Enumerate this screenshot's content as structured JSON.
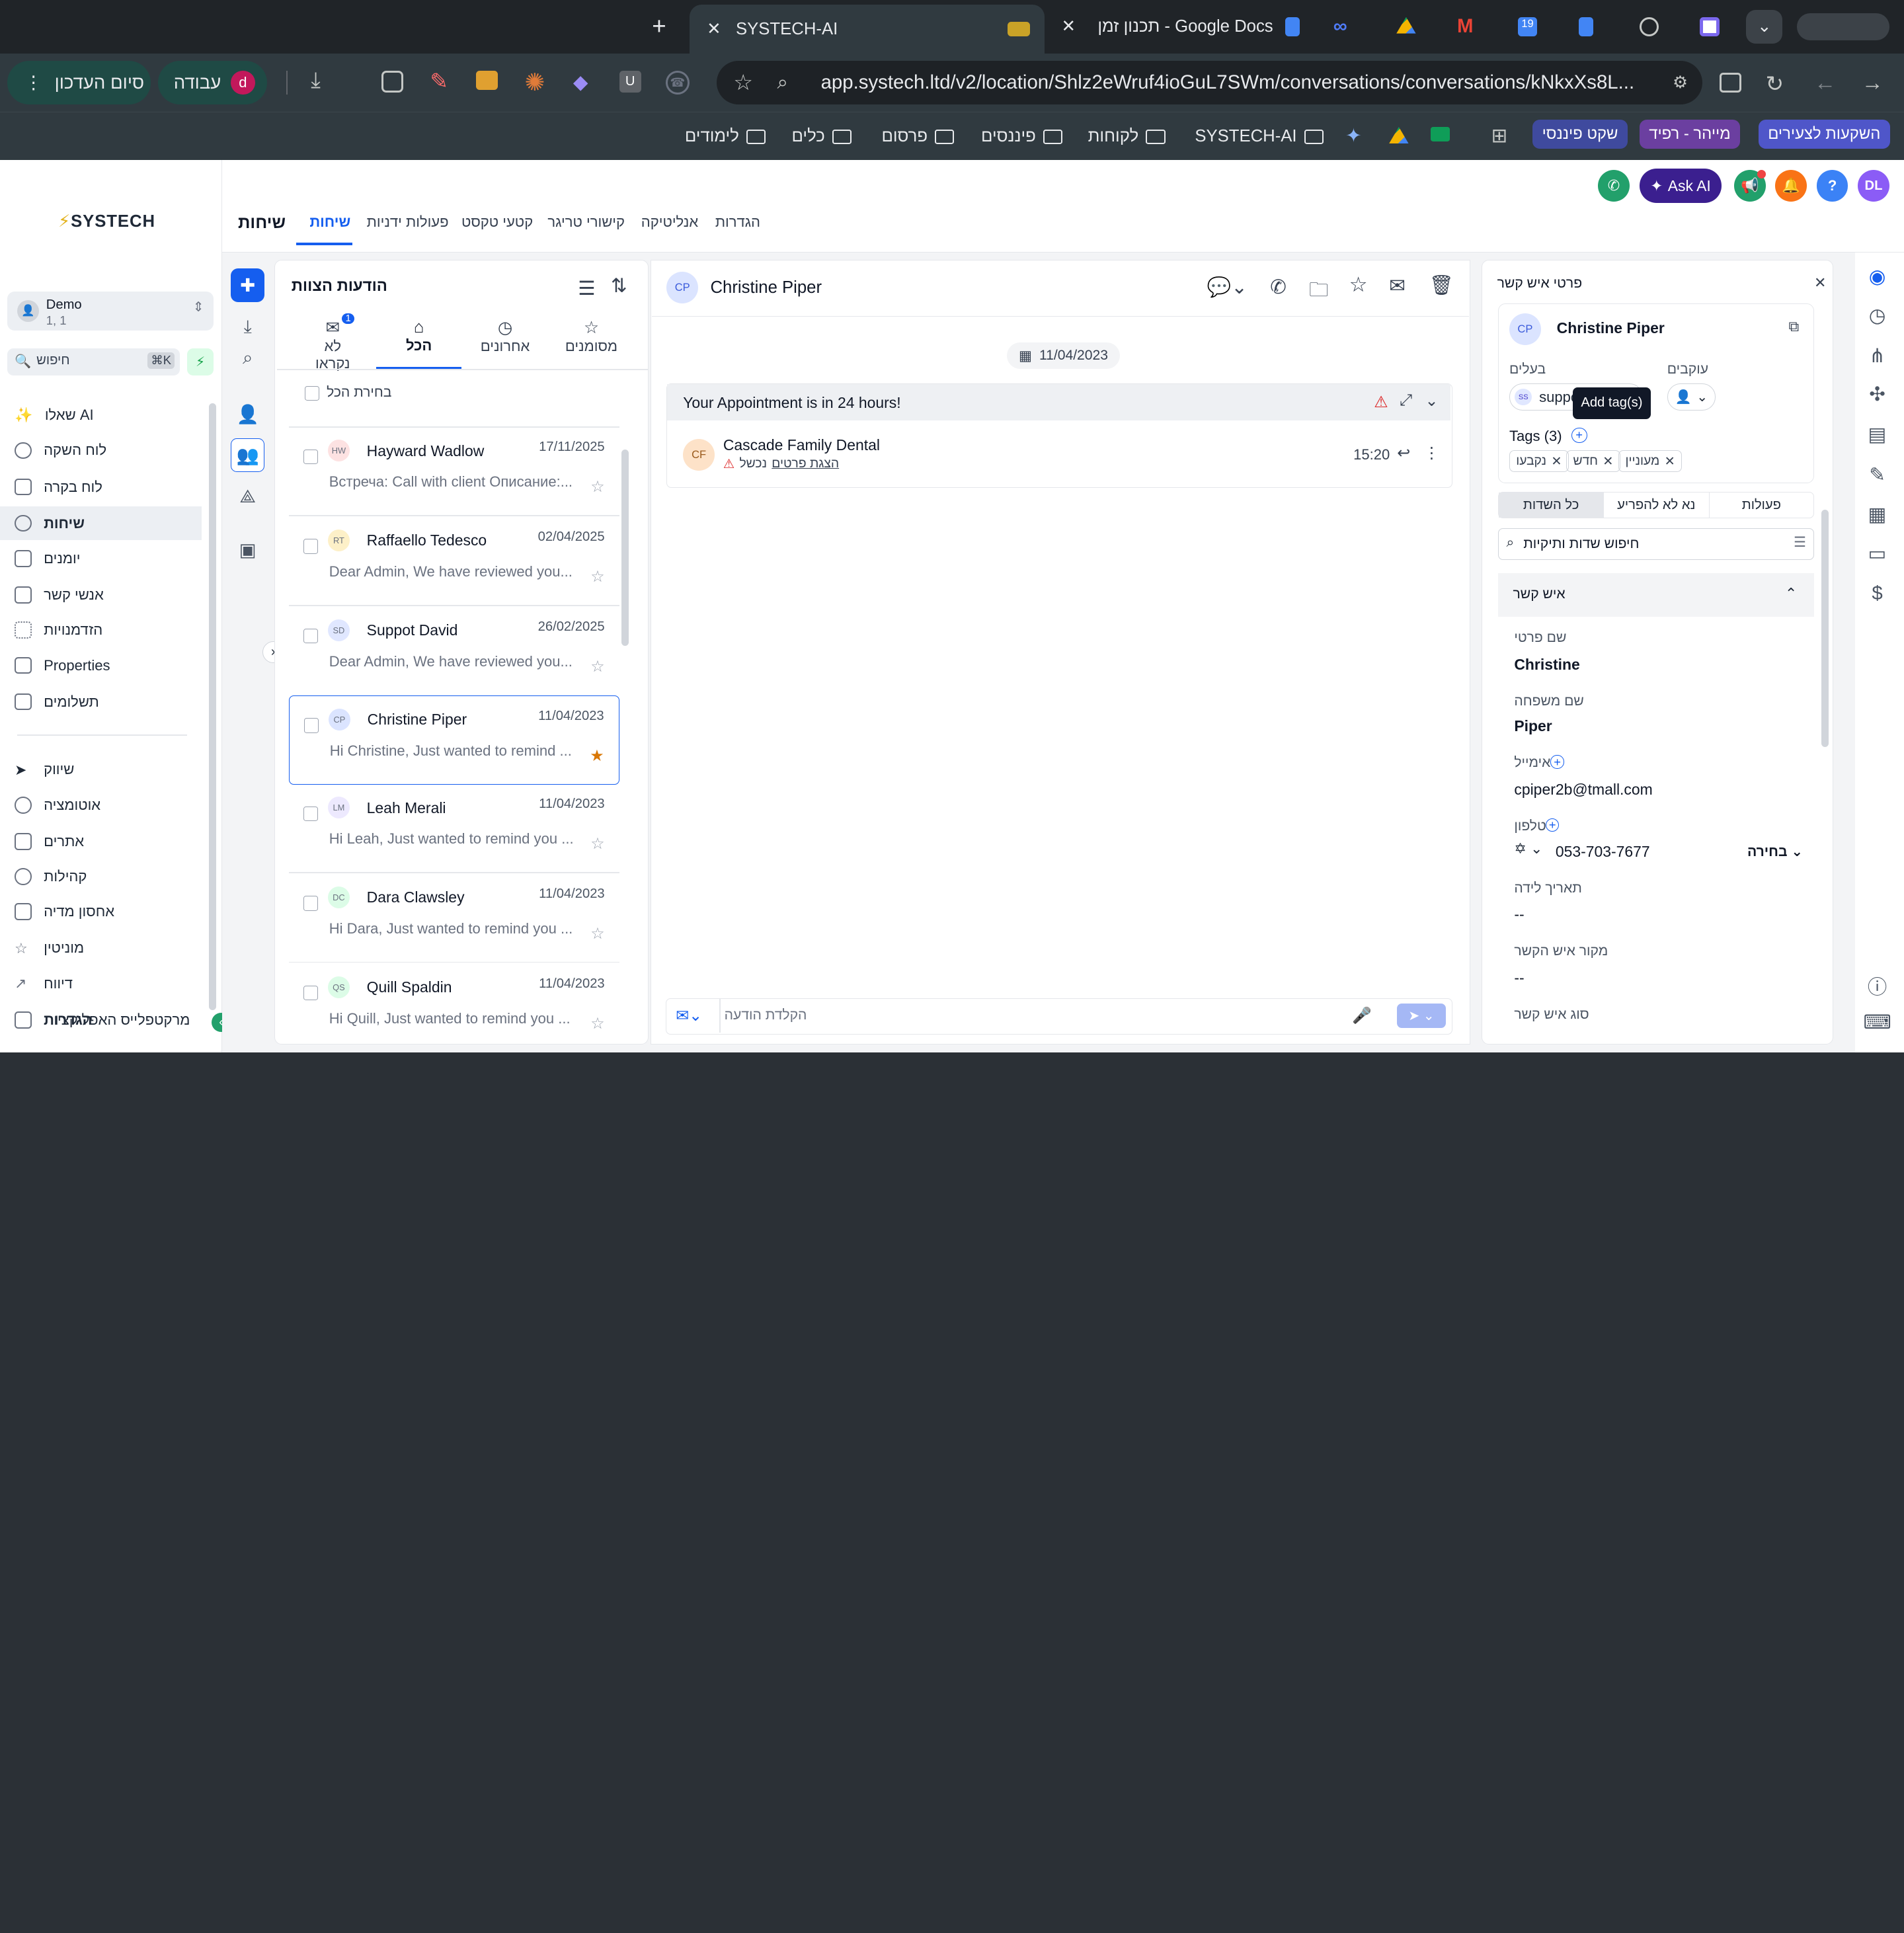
{
  "browser": {
    "tabs": [
      {
        "title": "SYSTECH-AI"
      },
      {
        "title": "תכנון זמן - Google Docs"
      }
    ],
    "new_tab": "+",
    "url": "app.systech.ltd/v2/location/Shlz2eWruf4ioGuL7SWm/conversations/conversations/kNkxXs8L...",
    "profile_label": "עבודה",
    "profile_initial": "d",
    "finish_update": "סיום העדכון",
    "bookmarks": [
      "השקעות לצעירים",
      "מייהר - רפיד",
      "שקט פיננסי",
      "SYSTECH-AI",
      "לקוחות",
      "פיננסים",
      "פרסום",
      "כלים",
      "לימודים"
    ]
  },
  "header": {
    "ask_ai": "Ask AI",
    "avatar": "DL",
    "help": "?",
    "page_title": "שיחות",
    "tabs": [
      "שיחות",
      "פעולות ידניות",
      "קטעי טקסט",
      "קישורי טריגר",
      "אנליטיקה",
      "הגדרות"
    ]
  },
  "sidebar": {
    "logo": "SYSTECH",
    "account_name": "Demo",
    "account_sub": "1, 1",
    "search_placeholder": "חיפוש",
    "search_shortcut": "⌘K",
    "items": [
      "שאלו AI",
      "לוח השקה",
      "לוח בקרה",
      "שיחות",
      "יומנים",
      "אנשי קשר",
      "הזדמנויות",
      "Properties",
      "תשלומים"
    ],
    "items2": [
      "שיווק",
      "אוטומציה",
      "אתרים",
      "קהילות",
      "אחסון מדיה",
      "מוניטין",
      "דיווח",
      "מרקטפלייס האפליקציות"
    ],
    "items2_overlay": "הגדרות"
  },
  "list": {
    "title": "הודעות הצוות",
    "tabs": [
      {
        "label": "לא נקראו",
        "badge": "1"
      },
      {
        "label": "הכל"
      },
      {
        "label": "אחרונים"
      },
      {
        "label": "מסומנים"
      }
    ],
    "select_all": "בחירת הכל",
    "conversations": [
      {
        "initials": "HW",
        "name": "Hayward Wadlow",
        "date": "17/11/2025",
        "preview": "Встреча: Call with client Описание:...",
        "starred": false
      },
      {
        "initials": "RT",
        "name": "Raffaello Tedesco",
        "date": "02/04/2025",
        "preview": "Dear Admin, We have reviewed you...",
        "starred": false
      },
      {
        "initials": "SD",
        "name": "Suppot David",
        "date": "26/02/2025",
        "preview": "Dear Admin, We have reviewed you...",
        "starred": false
      },
      {
        "initials": "CP",
        "name": "Christine Piper",
        "date": "11/04/2023",
        "preview": "Hi Christine, Just wanted to remind ...",
        "starred": true
      },
      {
        "initials": "LM",
        "name": "Leah Merali",
        "date": "11/04/2023",
        "preview": "Hi Leah, Just wanted to remind you ...",
        "starred": false
      },
      {
        "initials": "DC",
        "name": "Dara Clawsley",
        "date": "11/04/2023",
        "preview": "Hi Dara, Just wanted to remind you ...",
        "starred": false
      },
      {
        "initials": "QS",
        "name": "Quill Spaldin",
        "date": "11/04/2023",
        "preview": "Hi Quill, Just wanted to remind you ...",
        "starred": false
      }
    ]
  },
  "chat": {
    "contact_initials": "CP",
    "contact_name": "Christine Piper",
    "date_chip": "11/04/2023",
    "banner": "Your Appointment is in 24 hours!",
    "msg_initials": "CF",
    "msg_sender": "Cascade Family Dental",
    "msg_failed": "נכשל",
    "msg_details": "הצגת פרטים",
    "msg_time": "15:20",
    "composer_placeholder": "הקלדת הודעה"
  },
  "contact": {
    "title": "פרטי איש קשר",
    "initials": "CP",
    "name": "Christine Piper",
    "owner_label": "בעלים",
    "owner_value": "suppo",
    "owner_initials": "SS",
    "followers_label": "עוקבים",
    "tooltip": "Add tag(s)",
    "tags_label": "Tags (3)",
    "tags": [
      "מעוניין",
      "חדש",
      "נקבעו"
    ],
    "seg_tabs": [
      "פעולות",
      "נא לא להפריע",
      "כל השדות"
    ],
    "search_placeholder": "חיפוש שדות ותיקיות",
    "section": "איש קשר",
    "fields": [
      {
        "label": "שם פרטי",
        "value": "Christine"
      },
      {
        "label": "שם משפחה",
        "value": "Piper"
      },
      {
        "label": "אימייל",
        "value": "cpiper2b@tmall.com"
      },
      {
        "label": "טלפון",
        "value": "053-703-7677"
      },
      {
        "label": "תאריך לידה",
        "value": "--"
      },
      {
        "label": "מקור איש הקשר",
        "value": "--"
      },
      {
        "label": "סוג איש קשר",
        "value": ""
      }
    ],
    "phone_type": "בחירה"
  }
}
